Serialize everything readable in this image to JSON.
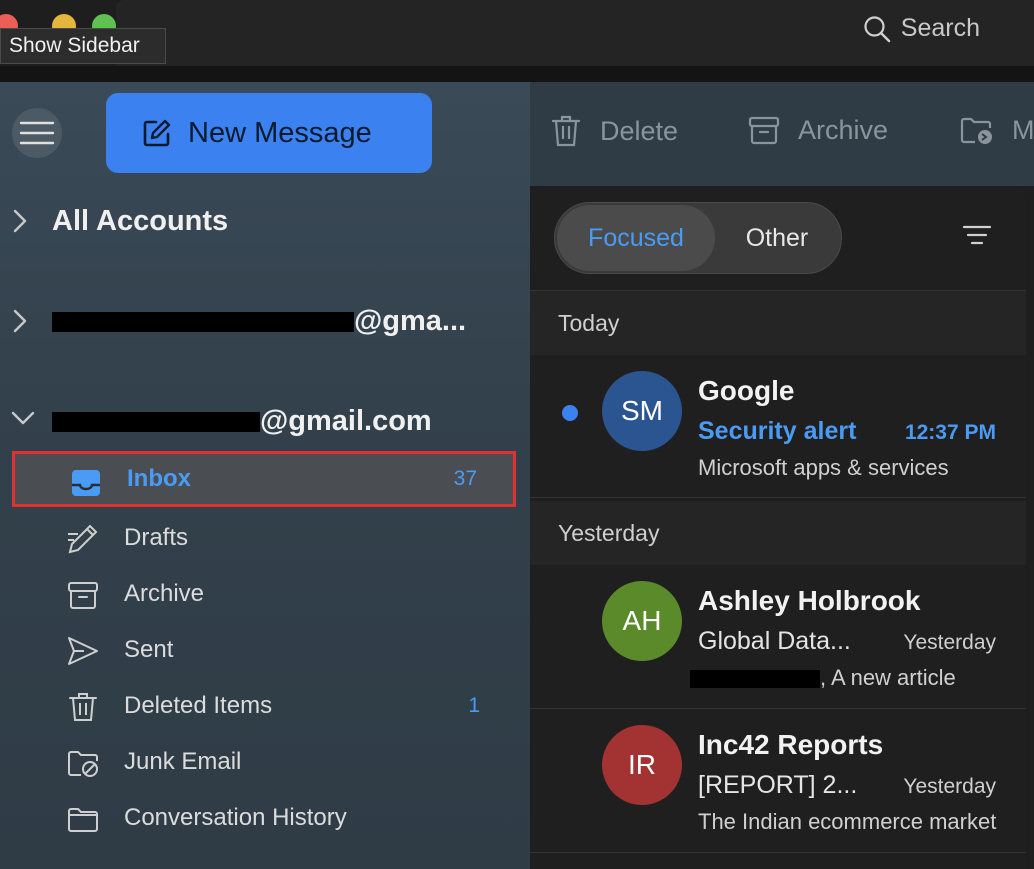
{
  "titlebar": {
    "tooltip": "Show Sidebar",
    "search_label": "Search"
  },
  "sidebar": {
    "new_message_label": "New Message",
    "accounts": [
      {
        "label": "All Accounts",
        "expanded": false
      },
      {
        "label_suffix": "@gma...",
        "expanded": false
      },
      {
        "label_suffix": "@gmail.com",
        "expanded": true
      }
    ],
    "folders": [
      {
        "label": "Inbox",
        "count": "37",
        "icon": "inbox-icon",
        "selected": true
      },
      {
        "label": "Drafts",
        "count": "",
        "icon": "pencil-icon"
      },
      {
        "label": "Archive",
        "count": "",
        "icon": "archive-icon"
      },
      {
        "label": "Sent",
        "count": "",
        "icon": "send-icon"
      },
      {
        "label": "Deleted Items",
        "count": "1",
        "icon": "trash-icon"
      },
      {
        "label": "Junk Email",
        "count": "",
        "icon": "junk-icon"
      },
      {
        "label": "Conversation History",
        "count": "",
        "icon": "folder-icon"
      }
    ]
  },
  "toolbar": {
    "delete_label": "Delete",
    "archive_label": "Archive",
    "move_label": "M"
  },
  "list": {
    "tabs": {
      "focused": "Focused",
      "other": "Other"
    },
    "groups": [
      {
        "header": "Today",
        "messages": [
          {
            "initials": "SM",
            "avatar_color": "#2b5591",
            "sender": "Google",
            "subject": "Security alert",
            "time": "12:37 PM",
            "preview": "Microsoft apps & services",
            "unread": true
          }
        ]
      },
      {
        "header": "Yesterday",
        "messages": [
          {
            "initials": "AH",
            "avatar_color": "#5a8a2a",
            "sender": "Ashley Holbrook",
            "subject": "Global Data...",
            "time": "Yesterday",
            "preview": ", A new article",
            "unread": false
          },
          {
            "initials": "IR",
            "avatar_color": "#a33232",
            "sender": "Inc42 Reports",
            "subject": "[REPORT] 2...",
            "time": "Yesterday",
            "preview": "The Indian ecommerce market",
            "unread": false
          }
        ]
      }
    ]
  },
  "colors": {
    "accent": "#3b82f0",
    "selection_outline": "#e03131"
  }
}
